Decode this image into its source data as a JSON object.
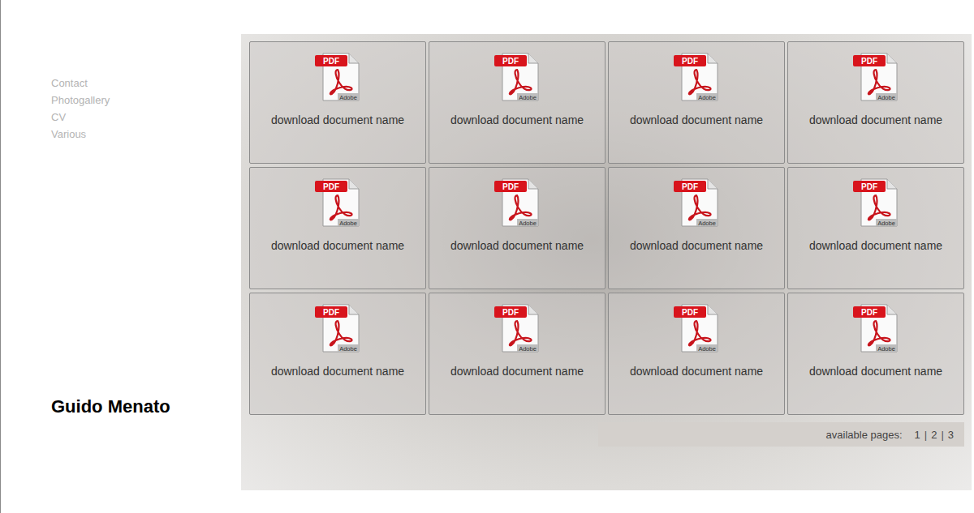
{
  "sidebar": {
    "items": [
      {
        "label": "Contact"
      },
      {
        "label": "Photogallery"
      },
      {
        "label": "CV"
      },
      {
        "label": "Various"
      }
    ]
  },
  "owner": {
    "name": "Guido Menato"
  },
  "documents": [
    {
      "label": "download document name",
      "badge": "PDF",
      "brand": "Adobe"
    },
    {
      "label": "download document name",
      "badge": "PDF",
      "brand": "Adobe"
    },
    {
      "label": "download document name",
      "badge": "PDF",
      "brand": "Adobe"
    },
    {
      "label": "download document name",
      "badge": "PDF",
      "brand": "Adobe"
    },
    {
      "label": "download document name",
      "badge": "PDF",
      "brand": "Adobe"
    },
    {
      "label": "download document name",
      "badge": "PDF",
      "brand": "Adobe"
    },
    {
      "label": "download document name",
      "badge": "PDF",
      "brand": "Adobe"
    },
    {
      "label": "download document name",
      "badge": "PDF",
      "brand": "Adobe"
    },
    {
      "label": "download document name",
      "badge": "PDF",
      "brand": "Adobe"
    },
    {
      "label": "download document name",
      "badge": "PDF",
      "brand": "Adobe"
    },
    {
      "label": "download document name",
      "badge": "PDF",
      "brand": "Adobe"
    },
    {
      "label": "download document name",
      "badge": "PDF",
      "brand": "Adobe"
    }
  ],
  "pagination": {
    "label": "available pages:",
    "separator": "|",
    "pages": [
      {
        "label": "1"
      },
      {
        "label": "2"
      },
      {
        "label": "3"
      }
    ]
  }
}
